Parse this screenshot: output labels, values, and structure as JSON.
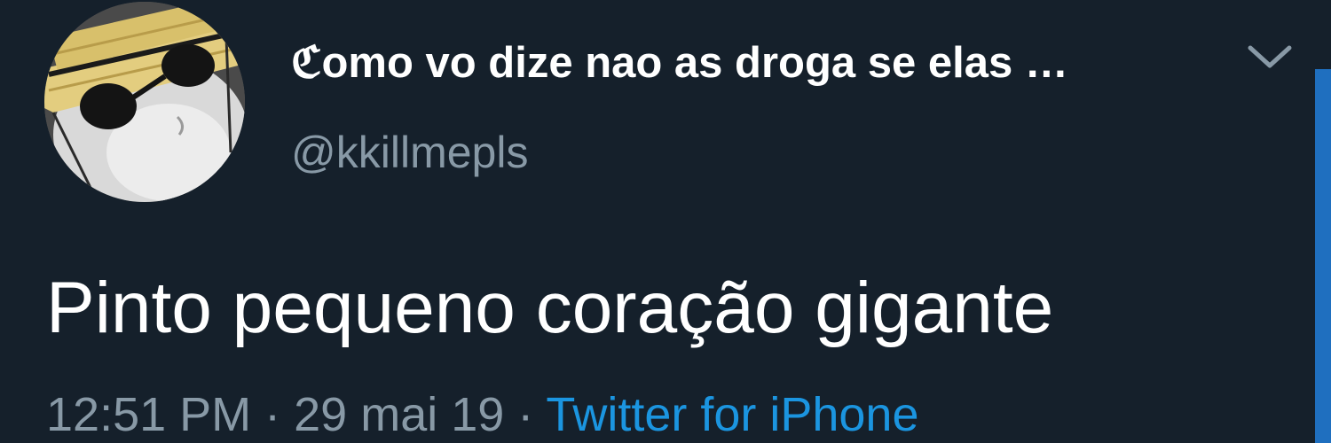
{
  "tweet": {
    "display_name_first": "ℭ",
    "display_name_rest": "omo vo dize nao as droga se elas …",
    "handle": "@kkillmepls",
    "text": "Pinto pequeno coração gigante",
    "time": "12:51 PM",
    "separator": " · ",
    "date": "29 mai 19",
    "source": "Twitter for iPhone"
  },
  "icons": {
    "menu": "chevron-down-icon",
    "avatar": "cat-avatar-image"
  },
  "colors": {
    "background": "#15202b",
    "primary_text": "#ffffff",
    "secondary_text": "#8899a6",
    "link": "#1b95e0"
  }
}
